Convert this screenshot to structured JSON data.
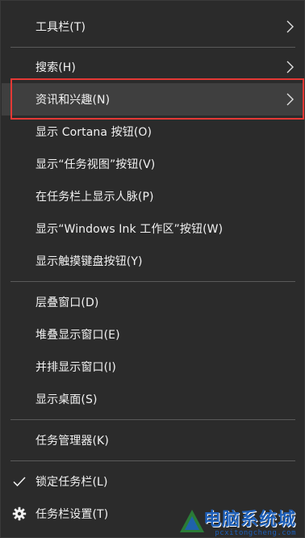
{
  "menu": {
    "items": [
      {
        "label": "工具栏(T)",
        "has_submenu": true
      },
      {
        "label": "搜索(H)",
        "has_submenu": true
      },
      {
        "label": "资讯和兴趣(N)",
        "has_submenu": true,
        "hovered": true,
        "highlighted": true
      },
      {
        "label": "显示 Cortana 按钮(O)"
      },
      {
        "label": "显示“任务视图”按钮(V)"
      },
      {
        "label": "在任务栏上显示人脉(P)"
      },
      {
        "label": "显示“Windows Ink 工作区”按钮(W)"
      },
      {
        "label": "显示触摸键盘按钮(Y)"
      },
      {
        "label": "层叠窗口(D)"
      },
      {
        "label": "堆叠显示窗口(E)"
      },
      {
        "label": "并排显示窗口(I)"
      },
      {
        "label": "显示桌面(S)"
      },
      {
        "label": "任务管理器(K)"
      },
      {
        "label": "锁定任务栏(L)",
        "checked": true,
        "icon": "checkmark-icon"
      },
      {
        "label": "任务栏设置(T)",
        "icon": "gear-icon"
      }
    ]
  },
  "watermark": {
    "text": "电脑系统城",
    "url": "pcxitongcheng.com"
  },
  "colors": {
    "menu_bg": "#2b2b2b",
    "text": "#f2f2f2",
    "separator": "#5a5a5a",
    "hover_bg": "#3f3f3f",
    "highlight_border": "#e53935",
    "watermark": "#1e5fb8"
  }
}
